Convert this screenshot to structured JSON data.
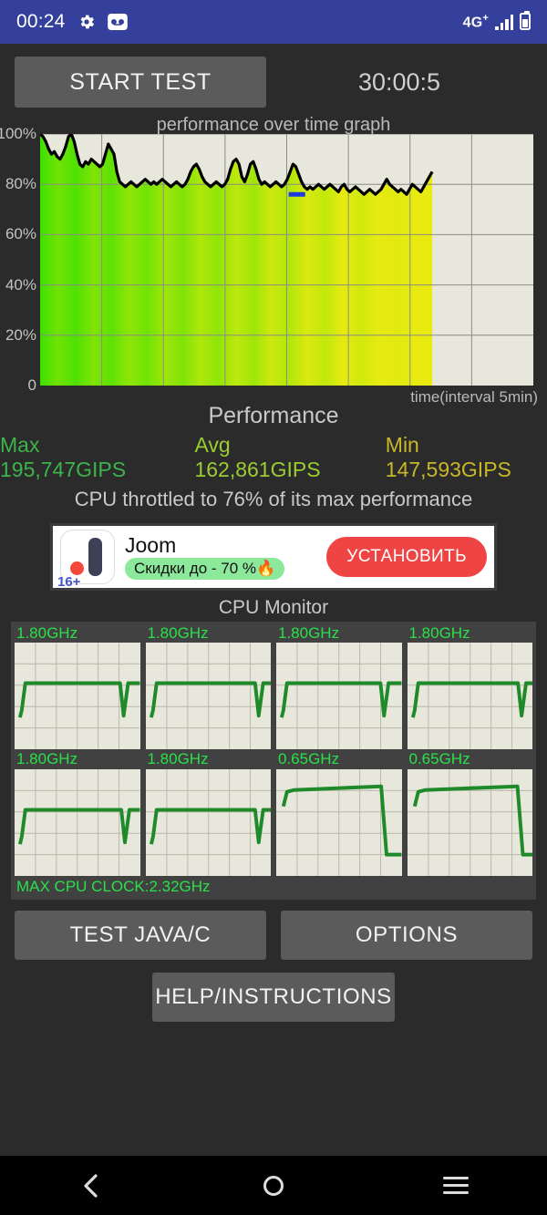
{
  "statusbar": {
    "time": "00:24",
    "gear_icon": "gear-icon",
    "voicemail_icon": "voicemail-icon",
    "network": "4G",
    "network_sup": "+",
    "signal_icon": "signal-bars-icon",
    "battery_icon": "battery-icon"
  },
  "toolbar": {
    "start_label": "START TEST",
    "timer": "30:00:5"
  },
  "graph": {
    "title": "performance over time graph",
    "x_caption": "time(interval 5min)"
  },
  "performance": {
    "heading": "Performance",
    "max_label": "Max 195,747GIPS",
    "avg_label": "Avg 162,861GIPS",
    "min_label": "Min 147,593GIPS",
    "max_color": "#3cb44b",
    "avg_color": "#9acd32",
    "min_color": "#c8b828",
    "throttle_note": "CPU throttled to 76% of its max performance"
  },
  "ad": {
    "brand": "Joom",
    "age_rating": "16+",
    "promo": "Скидки до - 70 %🔥",
    "cta_label": "УСТАНОВИТЬ",
    "cta_color": "#ef4444"
  },
  "cpu_monitor": {
    "title": "CPU Monitor",
    "max_clock": "MAX CPU CLOCK:2.32GHz",
    "cores": [
      {
        "freq": "1.80GHz"
      },
      {
        "freq": "1.80GHz"
      },
      {
        "freq": "1.80GHz"
      },
      {
        "freq": "1.80GHz"
      },
      {
        "freq": "1.80GHz"
      },
      {
        "freq": "1.80GHz"
      },
      {
        "freq": "0.65GHz"
      },
      {
        "freq": "0.65GHz"
      }
    ]
  },
  "buttons": {
    "test_java": "TEST JAVA/C",
    "options": "OPTIONS",
    "help": "HELP/INSTRUCTIONS"
  },
  "navbar": {
    "back_icon": "back-chevron-icon",
    "home_icon": "home-circle-icon",
    "recents_icon": "recents-menu-icon"
  },
  "chart_data": {
    "type": "area",
    "title": "performance over time graph",
    "xlabel": "time(interval 5min)",
    "ylabel": "",
    "ylim": [
      0,
      100
    ],
    "ytick_labels": [
      "100%",
      "80%",
      "60%",
      "40%",
      "20%",
      "0"
    ],
    "ytick_values": [
      100,
      80,
      60,
      40,
      20,
      0
    ],
    "grid": true,
    "x_gridline_count": 7,
    "data_end_fraction": 0.795,
    "series_name": "performance %",
    "values": [
      100,
      99,
      97,
      94,
      92,
      93,
      91,
      90,
      92,
      95,
      99,
      100,
      97,
      92,
      88,
      87,
      89,
      88,
      90,
      89,
      88,
      87,
      88,
      92,
      96,
      94,
      92,
      85,
      81,
      80,
      79,
      80,
      81,
      80,
      79,
      80,
      81,
      82,
      81,
      80,
      81,
      80,
      81,
      82,
      81,
      80,
      79,
      80,
      81,
      80,
      79,
      80,
      82,
      85,
      87,
      88,
      86,
      83,
      81,
      80,
      79,
      80,
      81,
      80,
      79,
      80,
      82,
      86,
      89,
      90,
      88,
      83,
      81,
      84,
      88,
      89,
      86,
      82,
      80,
      81,
      80,
      79,
      80,
      81,
      80,
      79,
      80,
      82,
      85,
      88,
      87,
      84,
      81,
      79,
      78,
      79,
      78,
      79,
      80,
      79,
      78,
      79,
      80,
      79,
      78,
      77,
      79,
      80,
      78,
      77,
      78,
      79,
      78,
      77,
      76,
      77,
      78,
      77,
      76,
      77,
      78,
      80,
      82,
      80,
      79,
      78,
      77,
      78,
      77,
      76,
      78,
      80,
      79,
      78,
      77,
      79,
      81,
      83,
      85
    ],
    "min_marker": {
      "color": "#1a3ae0",
      "x_fraction": 0.655,
      "value": 76
    },
    "fill_gradient": [
      "#3ee000",
      "#e8ea10"
    ],
    "line_color": "#000000"
  },
  "cpu_charts": [
    {
      "shape": "big-core",
      "plateau": 0.62,
      "dip_at": 0.87
    },
    {
      "shape": "big-core",
      "plateau": 0.62,
      "dip_at": 0.9
    },
    {
      "shape": "big-core",
      "plateau": 0.62,
      "dip_at": 0.86
    },
    {
      "shape": "big-core",
      "plateau": 0.62,
      "dip_at": 0.91
    },
    {
      "shape": "big-core",
      "plateau": 0.62,
      "dip_at": 0.88
    },
    {
      "shape": "big-core",
      "plateau": 0.62,
      "dip_at": 0.9
    },
    {
      "shape": "little-core",
      "plateau": 0.84,
      "dip_at": 0.88
    },
    {
      "shape": "little-core",
      "plateau": 0.84,
      "dip_at": 0.92
    }
  ]
}
